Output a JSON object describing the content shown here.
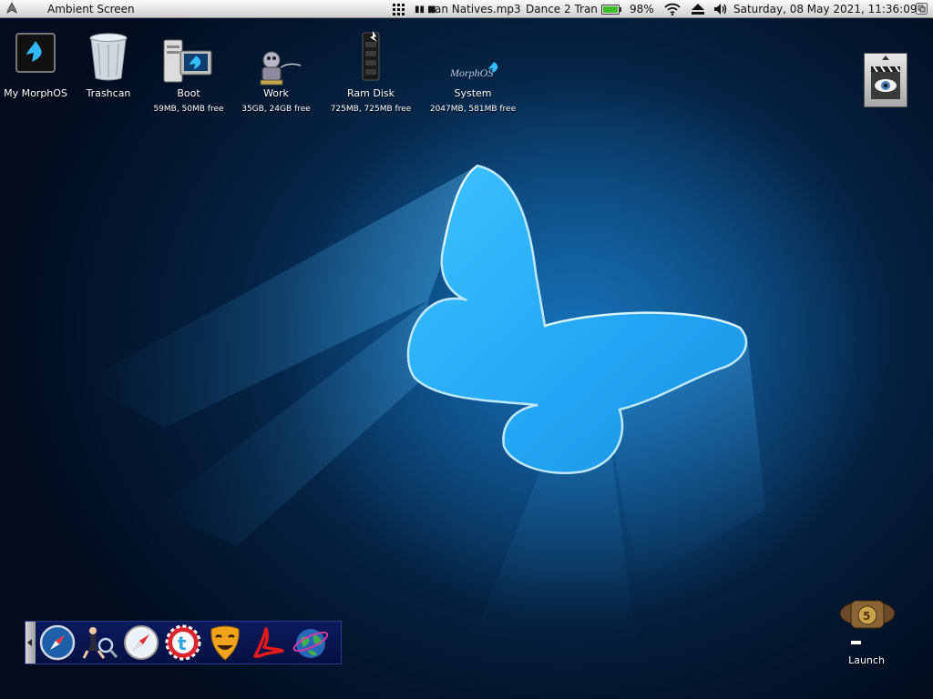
{
  "topbar": {
    "menu_icon": "morphos-logo-icon",
    "screen_title": "Ambient Screen",
    "grid_icon": "app-grid-icon",
    "media_controls": "▮▮ ■",
    "now_playing": "an Natives.mp3",
    "station": "Dance 2 Tran",
    "battery_level": 0.98,
    "battery_label": "98%",
    "wifi_icon": "wifi-icon",
    "eject_icon": "eject-icon",
    "volume_icon": "speaker-icon",
    "datetime": "Saturday, 08 May 2021, 11:36:09",
    "screen_switch_icon": "screen-depth-icon"
  },
  "desktop": {
    "icons": [
      {
        "label": "My MorphOS",
        "sub": "",
        "icon": "my-morphos-icon"
      },
      {
        "label": "Trashcan",
        "sub": "",
        "icon": "trashcan-icon"
      },
      {
        "label": "Boot",
        "sub": "59MB, 50MB free",
        "icon": "boot-drive-icon"
      },
      {
        "label": "Work",
        "sub": "35GB, 24GB free",
        "icon": "work-drive-icon"
      },
      {
        "label": "Ram Disk",
        "sub": "725MB, 725MB free",
        "icon": "ram-disk-icon"
      },
      {
        "label": "System",
        "sub": "2047MB, 581MB free",
        "icon": "system-drive-icon"
      }
    ],
    "launch": {
      "label": "Launch",
      "icon": "launch-icon"
    },
    "corner_icon": "iconify-eye-icon"
  },
  "dock": {
    "items": [
      {
        "name": "compass-browser-icon"
      },
      {
        "name": "pinup-search-icon"
      },
      {
        "name": "safari-icon"
      },
      {
        "name": "twitter-icon"
      },
      {
        "name": "theater-mask-icon"
      },
      {
        "name": "pdf-reader-icon"
      },
      {
        "name": "globe-icon"
      }
    ]
  },
  "colors": {
    "wallpaper": "#07335e",
    "butterfly": "#29aeff",
    "dock": "#0a1a5c",
    "battery_fill": "#3cbf2a"
  }
}
